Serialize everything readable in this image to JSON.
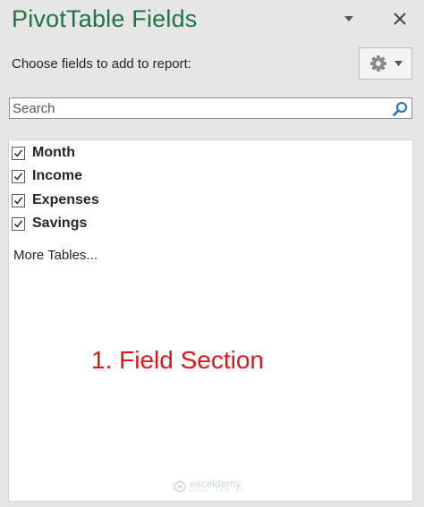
{
  "panel": {
    "title": "PivotTable Fields",
    "subtitle": "Choose fields to add to report:",
    "options_icon": "chevron-down-icon",
    "close_icon": "close-icon",
    "tools_icon": "gear-icon"
  },
  "search": {
    "placeholder": "Search",
    "value": ""
  },
  "fields": [
    {
      "label": "Month",
      "checked": true
    },
    {
      "label": "Income",
      "checked": true
    },
    {
      "label": "Expenses",
      "checked": true
    },
    {
      "label": "Savings",
      "checked": true
    }
  ],
  "more_tables": "More Tables...",
  "annotation": "1. Field Section",
  "watermark": {
    "name": "exceldemy",
    "tagline": "EXCEL · DATA · BI"
  },
  "colors": {
    "title": "#217346",
    "annotation": "#e0161b",
    "background": "#e6e6e6"
  }
}
